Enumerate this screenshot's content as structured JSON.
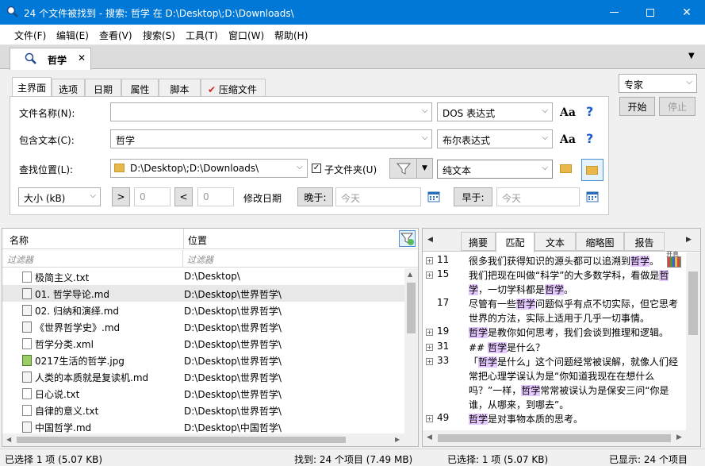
{
  "window": {
    "title": "24 个文件被找到 - 搜索: 哲学 在 D:\\Desktop\\;D:\\Downloads\\"
  },
  "menu": [
    "文件(F)",
    "编辑(E)",
    "查看(V)",
    "搜索(S)",
    "工具(T)",
    "窗口(W)",
    "帮助(H)"
  ],
  "doc_tab": {
    "label": "哲学"
  },
  "criteria_tabs": [
    "主界面",
    "选项",
    "日期",
    "属性",
    "脚本",
    "压缩文件"
  ],
  "form": {
    "filename_label": "文件名称(N):",
    "filename_value": "",
    "filename_mode": "DOS 表达式",
    "contains_label": "包含文本(C):",
    "contains_value": "哲学",
    "contains_mode": "布尔表达式",
    "location_label": "查找位置(L):",
    "location_value": "D:\\Desktop\\;D:\\Downloads\\",
    "subfolder_label": "子文件夹(U)",
    "subfolder_checked": true,
    "text_mode": "纯文本",
    "size_label": "大小 (kB)",
    "gt": ">",
    "gt_val": "0",
    "lt": "<",
    "lt_val": "0",
    "mod_date_label": "修改日期",
    "after_btn": "晚于:",
    "after_val": "今天",
    "before_btn": "早于:",
    "before_val": "今天"
  },
  "controls": {
    "mode": "专家",
    "start": "开始",
    "stop": "停止"
  },
  "results": {
    "col_name": "名称",
    "col_loc": "位置",
    "filter_name": "过滤器",
    "filter_loc": "过滤器",
    "rows": [
      {
        "name": "极简主义.txt",
        "loc": "D:\\Desktop\\",
        "icon": "txt"
      },
      {
        "name": "01. 哲学导论.md",
        "loc": "D:\\Desktop\\世界哲学\\",
        "icon": "md"
      },
      {
        "name": "02. 归纳和演绎.md",
        "loc": "D:\\Desktop\\世界哲学\\",
        "icon": "md"
      },
      {
        "name": "《世界哲学史》.md",
        "loc": "D:\\Desktop\\世界哲学\\",
        "icon": "md"
      },
      {
        "name": "哲学分类.xml",
        "loc": "D:\\Desktop\\世界哲学\\",
        "icon": "txt"
      },
      {
        "name": "0217生活的哲学.jpg",
        "loc": "D:\\Desktop\\世界哲学\\",
        "icon": "jpg"
      },
      {
        "name": "人类的本质就是复读机.md",
        "loc": "D:\\Desktop\\世界哲学\\",
        "icon": "md"
      },
      {
        "name": "日心说.txt",
        "loc": "D:\\Desktop\\世界哲学\\",
        "icon": "txt"
      },
      {
        "name": "自律的意义.txt",
        "loc": "D:\\Desktop\\世界哲学\\",
        "icon": "txt"
      },
      {
        "name": "中国哲学.md",
        "loc": "D:\\Desktop\\中国哲学\\",
        "icon": "md"
      }
    ]
  },
  "preview": {
    "tabs": [
      "摘要",
      "匹配",
      "文本",
      "缩略图",
      "报告"
    ],
    "corner_label": "开息",
    "lines": [
      {
        "num": "11",
        "plus": true,
        "parts": [
          [
            "很多我们获得知识的源头都可以追溯到",
            false
          ],
          [
            "哲学",
            true
          ],
          [
            "。",
            false
          ]
        ]
      },
      {
        "num": "15",
        "plus": true,
        "parts": [
          [
            "我们把现在叫做“科学”的大多数学科，看做是",
            false
          ],
          [
            "哲学",
            true
          ],
          [
            "，一切学科都是",
            false
          ],
          [
            "哲学",
            true
          ],
          [
            "。",
            false
          ]
        ]
      },
      {
        "num": "17",
        "plus": false,
        "parts": [
          [
            "尽管有一些",
            false
          ],
          [
            "哲学",
            true
          ],
          [
            "问题似乎有点不切实际，但它思考世界的方法，实际上适用于几乎一切事情。",
            false
          ]
        ]
      },
      {
        "num": "19",
        "plus": true,
        "parts": [
          [
            "哲学",
            true
          ],
          [
            "是教你如何思考，我们会谈到推理和逻辑。",
            false
          ]
        ]
      },
      {
        "num": "31",
        "plus": true,
        "parts": [
          [
            "## ",
            false
          ],
          [
            "哲学",
            true
          ],
          [
            "是什么？",
            false
          ]
        ]
      },
      {
        "num": "33",
        "plus": true,
        "parts": [
          [
            "「",
            false
          ],
          [
            "哲学",
            true
          ],
          [
            "是什么」这个问题经常被误解，就像人们经常把心理学误认为是“你知道我现在在想什么吗？”一样，",
            false
          ],
          [
            "哲学",
            true
          ],
          [
            "常常被误认为是保安三问“你是谁，从哪来，到哪去”。",
            false
          ]
        ]
      },
      {
        "num": "49",
        "plus": true,
        "parts": [
          [
            "哲学",
            true
          ],
          [
            "是对事物本质的思考。",
            false
          ]
        ]
      }
    ]
  },
  "status": {
    "selected_left": "已选择 1 项 (5.07 KB)",
    "found": "找到: 24 个项目 (7.49 MB)",
    "selected_right": "已选择: 1 项 (5.07 KB)",
    "shown": "已显示: 24 个项目"
  }
}
